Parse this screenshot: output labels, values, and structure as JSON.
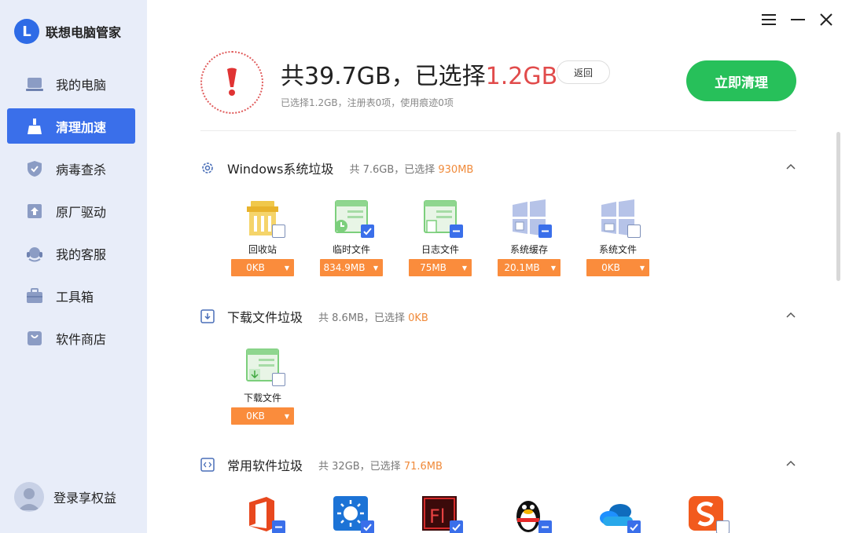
{
  "app": {
    "title": "联想电脑管家",
    "logo_letter": "L"
  },
  "sidebar": {
    "items": [
      {
        "label": "我的电脑",
        "icon": "laptop-icon"
      },
      {
        "label": "清理加速",
        "icon": "broom-icon",
        "active": true
      },
      {
        "label": "病毒查杀",
        "icon": "shield-icon"
      },
      {
        "label": "原厂驱动",
        "icon": "driver-upload-icon"
      },
      {
        "label": "我的客服",
        "icon": "headset-icon"
      },
      {
        "label": "工具箱",
        "icon": "toolbox-icon"
      },
      {
        "label": "软件商店",
        "icon": "store-bag-icon"
      }
    ],
    "login_label": "登录享权益"
  },
  "summary": {
    "main_prefix": "共39.7GB，已选择",
    "main_selected": "1.2GB",
    "sub": "已选择1.2GB，注册表0项，使用痕迹0项",
    "back_label": "返回",
    "clean_label": "立即清理"
  },
  "sections": {
    "windows": {
      "title": "Windows系统垃圾",
      "meta_prefix": "共 7.6GB，已选择",
      "meta_selected": "930MB",
      "items": [
        {
          "label": "回收站",
          "size": "0KB",
          "state": "empty"
        },
        {
          "label": "临时文件",
          "size": "834.9MB",
          "state": "checked"
        },
        {
          "label": "日志文件",
          "size": "75MB",
          "state": "partial"
        },
        {
          "label": "系统缓存",
          "size": "20.1MB",
          "state": "partial"
        },
        {
          "label": "系统文件",
          "size": "0KB",
          "state": "empty"
        }
      ]
    },
    "downloads": {
      "title": "下载文件垃圾",
      "meta_prefix": "共 8.6MB，已选择",
      "meta_selected": "0KB",
      "items": [
        {
          "label": "下载文件",
          "size": "0KB",
          "state": "empty"
        }
      ]
    },
    "software": {
      "title": "常用软件垃圾",
      "meta_prefix": "共 32GB，已选择",
      "meta_selected": "71.6MB",
      "items": [
        {
          "icon": "office-icon",
          "state": "partial"
        },
        {
          "icon": "weather-app-icon",
          "state": "checked"
        },
        {
          "icon": "flash-icon",
          "state": "checked"
        },
        {
          "icon": "qq-penguin-icon",
          "state": "partial"
        },
        {
          "icon": "onedrive-icon",
          "state": "checked"
        },
        {
          "icon": "sogou-icon",
          "state": "empty"
        }
      ]
    }
  },
  "colors": {
    "accent": "#3a6fea",
    "clean_green": "#27c05a",
    "highlight_red": "#e14b4b",
    "orange": "#fa8c3c",
    "sidebar_bg": "#e8edf9"
  }
}
